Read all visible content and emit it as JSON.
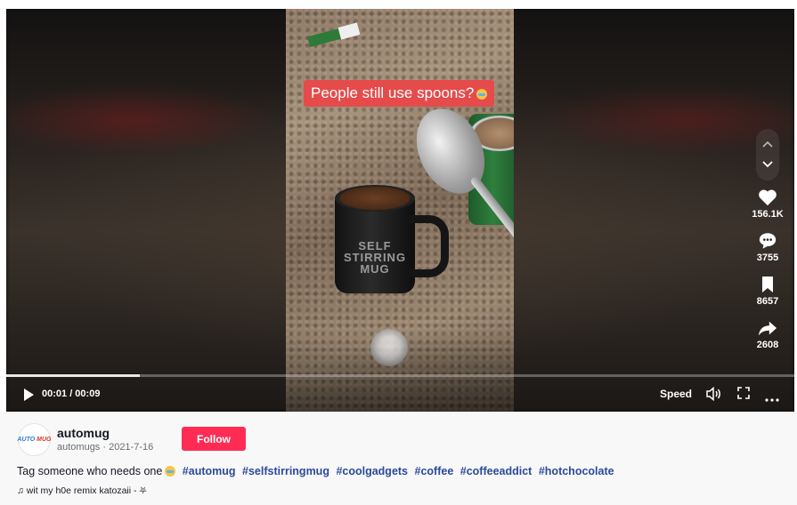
{
  "video": {
    "caption_overlay": "People still use spoons?",
    "mug_print": "SELF STIRRING MUG",
    "time": "00:01 / 00:09",
    "progress": 0.17,
    "speed_label": "Speed"
  },
  "actions": {
    "likes": "156.1K",
    "comments": "3755",
    "saves": "8657",
    "shares": "2608"
  },
  "author": {
    "avatar_text_a": "AUTO",
    "avatar_text_b": "MUG",
    "name": "automug",
    "handle_date": "automugs · 2021-7-16",
    "follow_label": "Follow"
  },
  "description": {
    "text": "Tag someone who needs one",
    "tags": [
      "#automug",
      "#selfstirringmug",
      "#coolgadgets",
      "#coffee",
      "#coffeeaddict",
      "#hotchocolate"
    ]
  },
  "music": "♫ wit my h0e remix katozaii - ⛧",
  "colors": {
    "accent": "#fe2c55",
    "hashtag": "#2b4a9a"
  },
  "icons": [
    "chevron-up-icon",
    "chevron-down-icon",
    "heart-icon",
    "comment-icon",
    "bookmark-icon",
    "share-icon",
    "play-icon",
    "volume-icon",
    "fullscreen-icon",
    "more-icon"
  ]
}
